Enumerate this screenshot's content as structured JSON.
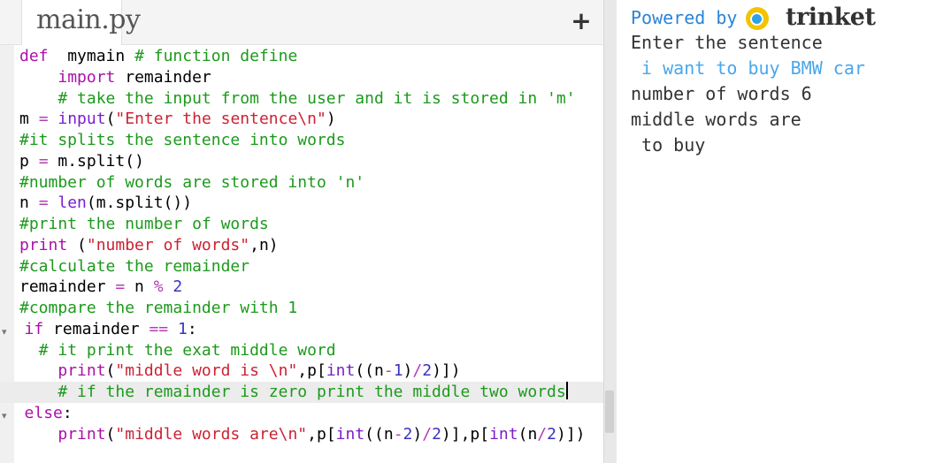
{
  "editor": {
    "file_tab": "main.py",
    "add_file_icon": "plus-icon",
    "lines": [
      [
        [
          "kw",
          "def"
        ],
        [
          "",
          "  mymain "
        ],
        [
          "cm",
          "# function define"
        ]
      ],
      [
        [
          "",
          "    "
        ],
        [
          "kw",
          "import"
        ],
        [
          "",
          " remainder"
        ]
      ],
      [
        [
          "",
          "    "
        ],
        [
          "cm",
          "# take the input from the user and it is stored in 'm'"
        ]
      ],
      [
        [
          "",
          "m "
        ],
        [
          "op",
          "="
        ],
        [
          "bi",
          " input"
        ],
        [
          "",
          "("
        ],
        [
          "str",
          "\"Enter the sentence\\n\""
        ],
        [
          "",
          ")"
        ]
      ],
      [
        [
          "cm",
          "#it splits the sentence into words"
        ]
      ],
      [
        [
          "",
          "p "
        ],
        [
          "op",
          "="
        ],
        [
          "",
          " m.split()"
        ]
      ],
      [
        [
          "cm",
          "#number of words are stored into 'n'"
        ]
      ],
      [
        [
          "",
          "n "
        ],
        [
          "op",
          "="
        ],
        [
          "bi",
          " len"
        ],
        [
          "",
          "(m.split())"
        ]
      ],
      [
        [
          "cm",
          "#print the number of words"
        ]
      ],
      [
        [
          "kw",
          "print"
        ],
        [
          "",
          " ("
        ],
        [
          "str",
          "\"number of words\""
        ],
        [
          "",
          ",n)"
        ]
      ],
      [
        [
          "cm",
          "#calculate the remainder"
        ]
      ],
      [
        [
          "",
          "remainder "
        ],
        [
          "op",
          "="
        ],
        [
          "",
          " n "
        ],
        [
          "op",
          "%"
        ],
        [
          "num",
          " 2"
        ]
      ],
      [
        [
          "cm",
          "#compare the remainder with 1"
        ]
      ],
      [
        [
          "kw",
          "if"
        ],
        [
          "",
          " remainder "
        ],
        [
          "op",
          "=="
        ],
        [
          "num",
          " 1"
        ],
        [
          "",
          ":"
        ]
      ],
      [
        [
          "",
          "  "
        ],
        [
          "cm",
          "# it print the exat middle word"
        ]
      ],
      [
        [
          "",
          "    "
        ],
        [
          "kw",
          "print"
        ],
        [
          "",
          "("
        ],
        [
          "str",
          "\"middle word is \\n\""
        ],
        [
          "",
          ",p["
        ],
        [
          "bi",
          "int"
        ],
        [
          "",
          "((n"
        ],
        [
          "op",
          "-"
        ],
        [
          "num",
          "1"
        ],
        [
          "",
          ")"
        ],
        [
          "op",
          "/"
        ],
        [
          "num",
          "2"
        ],
        [
          "",
          ")])"
        ]
      ],
      [
        [
          "",
          "    "
        ],
        [
          "cm",
          "# if the remainder is zero print the middle two words"
        ]
      ],
      [
        [
          "kw",
          "else"
        ],
        [
          "",
          ":"
        ]
      ],
      [
        [
          "",
          "    "
        ],
        [
          "kw",
          "print"
        ],
        [
          "",
          "("
        ],
        [
          "str",
          "\"middle words are\\n\""
        ],
        [
          "",
          ",p["
        ],
        [
          "bi",
          "int"
        ],
        [
          "",
          "((n"
        ],
        [
          "op",
          "-"
        ],
        [
          "num",
          "2"
        ],
        [
          "",
          ")"
        ],
        [
          "op",
          "/"
        ],
        [
          "num",
          "2"
        ],
        [
          "",
          ")],p["
        ],
        [
          "bi",
          "int"
        ],
        [
          "",
          "(n"
        ],
        [
          "op",
          "/"
        ],
        [
          "num",
          "2"
        ],
        [
          "",
          ")])"
        ]
      ]
    ],
    "fold_lines": [
      13,
      17
    ],
    "active_line": 16,
    "colors": {
      "keyword": "#aa11aa",
      "builtin": "#7a1ecc",
      "string": "#cc2233",
      "number": "#3a32c2",
      "comment": "#1c9a1c",
      "operator": "#b53cb5"
    }
  },
  "output": {
    "powered_by": "Powered by",
    "brand": "trinket",
    "brand_icon": "trinket-logo-icon",
    "console_lines": [
      {
        "text": "Enter the sentence",
        "type": "out"
      },
      {
        "text": " i want to buy BMW car",
        "type": "in"
      },
      {
        "text": "number of words 6",
        "type": "out"
      },
      {
        "text": "middle words are",
        "type": "out"
      },
      {
        "text": " to buy",
        "type": "out"
      }
    ],
    "colors": {
      "link": "#2a84d8",
      "input_text": "#4aa6ea",
      "output_text": "#333333"
    }
  }
}
